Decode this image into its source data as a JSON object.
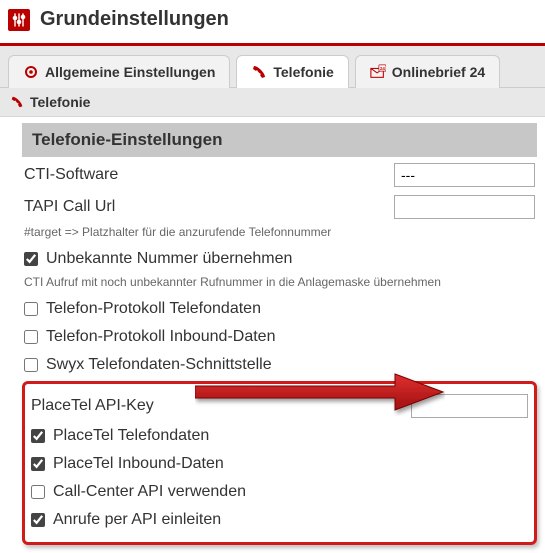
{
  "header": {
    "title": "Grundeinstellungen"
  },
  "tabs": [
    {
      "label": "Allgemeine Einstellungen",
      "icon": "gear",
      "active": false
    },
    {
      "label": "Telefonie",
      "icon": "phone",
      "active": true
    },
    {
      "label": "Onlinebrief 24",
      "icon": "mail-badge",
      "active": false
    }
  ],
  "section": {
    "title": "Telefonie",
    "icon": "phone"
  },
  "subheader": "Telefonie-Einstellungen",
  "fields": {
    "cti_software_label": "CTI-Software",
    "cti_software_value": "---",
    "tapi_url_label": "TAPI Call Url",
    "tapi_url_value": ""
  },
  "hints": {
    "target": "#target => Platzhalter für die anzurufende Telefonnummer",
    "cti_unknown": "CTI Aufruf mit noch unbekannter Rufnummer in die Anlagemaske übernehmen"
  },
  "checks_top": [
    {
      "label": "Unbekannte Nummer übernehmen",
      "checked": true
    },
    {
      "label": "Telefon-Protokoll Telefondaten",
      "checked": false
    },
    {
      "label": "Telefon-Protokoll Inbound-Daten",
      "checked": false
    },
    {
      "label": "Swyx Telefondaten-Schnittstelle",
      "checked": false
    }
  ],
  "placetel": {
    "api_key_label": "PlaceTel API-Key",
    "api_key_value": "",
    "checks": [
      {
        "label": "PlaceTel Telefondaten",
        "checked": true
      },
      {
        "label": "PlaceTel Inbound-Daten",
        "checked": true
      },
      {
        "label": "Call-Center API verwenden",
        "checked": false
      },
      {
        "label": "Anrufe per API einleiten",
        "checked": true
      }
    ]
  }
}
